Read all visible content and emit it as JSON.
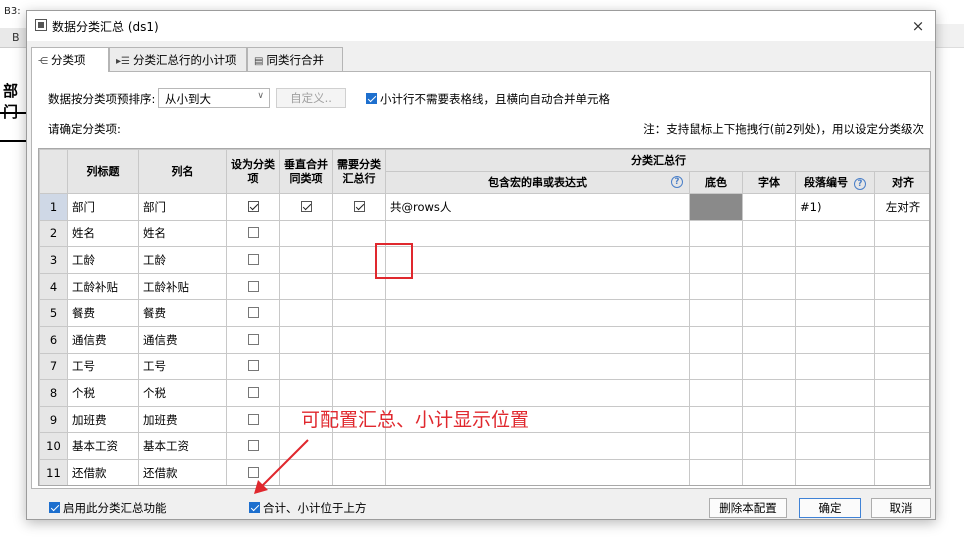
{
  "background": {
    "cell_ref": "B3:",
    "column_b": "B",
    "cell_text": "部门"
  },
  "dialog": {
    "title": "数据分类汇总 (ds1)",
    "close": "×"
  },
  "tabs": [
    {
      "label": "分类项",
      "icon": "category-tree-icon"
    },
    {
      "label": "分类汇总行的小计项",
      "icon": "subtotal-list-icon"
    },
    {
      "label": "同类行合并",
      "icon": "merge-rows-icon"
    }
  ],
  "options": {
    "sort_label": "数据按分类项预排序:",
    "sort_value": "从小到大",
    "custom_button": "自定义..",
    "no_gridline_label": "小计行不需要表格线，且横向自动合并单元格",
    "confirm_label": "请确定分类项:",
    "note": "注：支持鼠标上下拖拽行(前2列处)，用以设定分类级次"
  },
  "grid": {
    "headers": {
      "title": "列标题",
      "name": "列名",
      "set_cat": "设为分类项",
      "vmerge": "垂直合并同类项",
      "need_sum": "需要分类汇总行",
      "group": "分类汇总行",
      "expr": "包含宏的串或表达式",
      "bg": "底色",
      "font": "字体",
      "para": "段落编号",
      "align": "对齐"
    },
    "rows": [
      {
        "n": "1",
        "title": "部门",
        "name": "部门",
        "set": true,
        "vmerge": true,
        "need": true,
        "expr": "共@rows人",
        "para": "#1)",
        "align": "左对齐"
      },
      {
        "n": "2",
        "title": "姓名",
        "name": "姓名",
        "set": false
      },
      {
        "n": "3",
        "title": "工龄",
        "name": "工龄",
        "set": false
      },
      {
        "n": "4",
        "title": "工龄补贴",
        "name": "工龄补贴",
        "set": false
      },
      {
        "n": "5",
        "title": "餐费",
        "name": "餐费",
        "set": false
      },
      {
        "n": "6",
        "title": "通信费",
        "name": "通信费",
        "set": false
      },
      {
        "n": "7",
        "title": "工号",
        "name": "工号",
        "set": false
      },
      {
        "n": "8",
        "title": "个税",
        "name": "个税",
        "set": false
      },
      {
        "n": "9",
        "title": "加班费",
        "name": "加班费",
        "set": false
      },
      {
        "n": "10",
        "title": "基本工资",
        "name": "基本工资",
        "set": false
      },
      {
        "n": "11",
        "title": "还借款",
        "name": "还借款",
        "set": false
      }
    ]
  },
  "annotation": "可配置汇总、小计显示位置",
  "footer": {
    "enable_label": "启用此分类汇总功能",
    "top_label": "合计、小计位于上方",
    "delete_button": "删除本配置",
    "ok_button": "确定",
    "cancel_button": "取消"
  },
  "colors": {
    "accent": "#1d6fce",
    "annotation_red": "#e0282e",
    "swatch_gray": "#8a8a8a"
  }
}
